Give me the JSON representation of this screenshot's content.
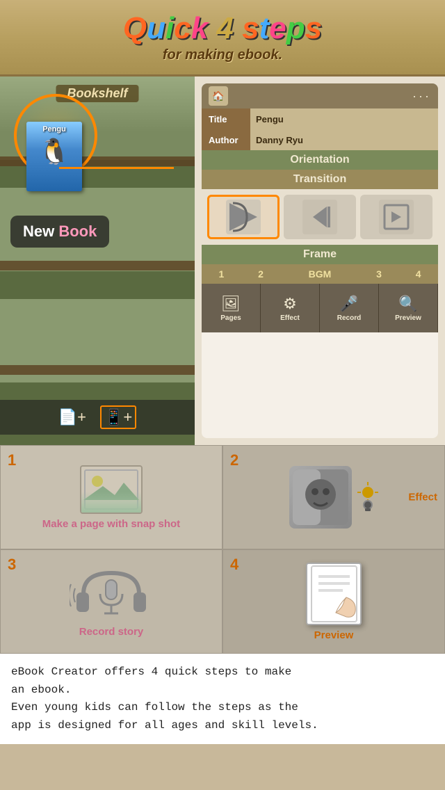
{
  "header": {
    "title_line1": "Quick 4 steps",
    "title_line2": "for making ebook.",
    "title_chars": [
      "Q",
      "u",
      "i",
      "c",
      "k",
      " ",
      "4",
      " ",
      "s",
      "t",
      "e",
      "p",
      "s"
    ],
    "title_colors": [
      "#ff6622",
      "#44aaff",
      "#44cc44",
      "#ff6622",
      "#ff4488",
      "transparent",
      "#44cc44",
      "transparent",
      "#ff6622",
      "#44aaff",
      "#ff4488",
      "#44cc44",
      "#ff6622"
    ]
  },
  "left_phone": {
    "bookshelf_label": "Bookshelf",
    "book_title": "Pengu",
    "new_book_label": "New Book",
    "new_word": "New",
    "book_word": "Book"
  },
  "right_phone": {
    "title_label": "Title",
    "title_value": "Pengu",
    "author_label": "Author",
    "author_value": "Danny Ryu",
    "orientation_label": "Orientation",
    "transition_label": "Transition",
    "frame_label": "Frame",
    "bgm_label": "BGM",
    "bgm_numbers": [
      "1",
      "2",
      "3",
      "4"
    ],
    "tabs": [
      {
        "label": "Pages",
        "icon": "🖼"
      },
      {
        "label": "Effect",
        "icon": "⚙"
      },
      {
        "label": "Record",
        "icon": "🎤"
      },
      {
        "label": "Preview",
        "icon": "🔍"
      }
    ],
    "dots": "···",
    "home_icon": "🏠"
  },
  "steps": [
    {
      "number": "1",
      "label": "Make a page with snap shot",
      "icon_type": "image"
    },
    {
      "number": "2",
      "label": "Effect",
      "icon_type": "face"
    },
    {
      "number": "3",
      "label": "Record story",
      "icon_type": "mic"
    },
    {
      "number": "4",
      "label": "Preview",
      "icon_type": "book"
    }
  ],
  "bottom_text": {
    "line1": "eBook Creator offers 4 quick steps to make",
    "line2": "an ebook.",
    "line3": "Even young kids can follow the steps as the",
    "line4": "app is designed for all ages and skill levels."
  }
}
